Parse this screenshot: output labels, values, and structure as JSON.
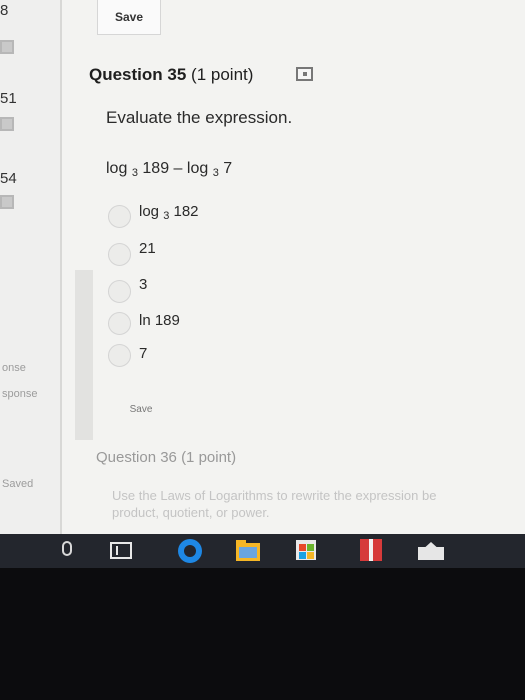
{
  "sidebar": {
    "numbers": [
      "8",
      "51",
      "54"
    ],
    "labels": [
      "onse",
      "sponse",
      "Saved"
    ]
  },
  "toolbar": {
    "save_top": "Save"
  },
  "question35": {
    "title": "Question 35",
    "points": "(1 point)",
    "prompt": "Evaluate the expression.",
    "expression": {
      "log": "log",
      "base": "3",
      "a": "189",
      "minus": "–",
      "b": "7"
    },
    "options": [
      {
        "log": "log",
        "base": "3",
        "value": "182"
      },
      {
        "value": "21"
      },
      {
        "value": "3"
      },
      {
        "value": "ln 189"
      },
      {
        "value": "7"
      }
    ],
    "save_bottom": "Save"
  },
  "question36": {
    "title": "Question 36",
    "points": "(1 point)",
    "text_line1": "Use the Laws of Logarithms to rewrite the expression be",
    "text_line2": "product, quotient, or power."
  },
  "taskbar": {
    "icons": [
      "microphone-icon",
      "task-view-icon",
      "edge-icon",
      "file-explorer-icon",
      "store-icon",
      "gift-icon",
      "mail-icon"
    ]
  },
  "colors": {
    "accent_blue": "#1e88e5",
    "folder": "#f5b626",
    "gift": "#d63a3a",
    "taskbar": "#23262d"
  }
}
